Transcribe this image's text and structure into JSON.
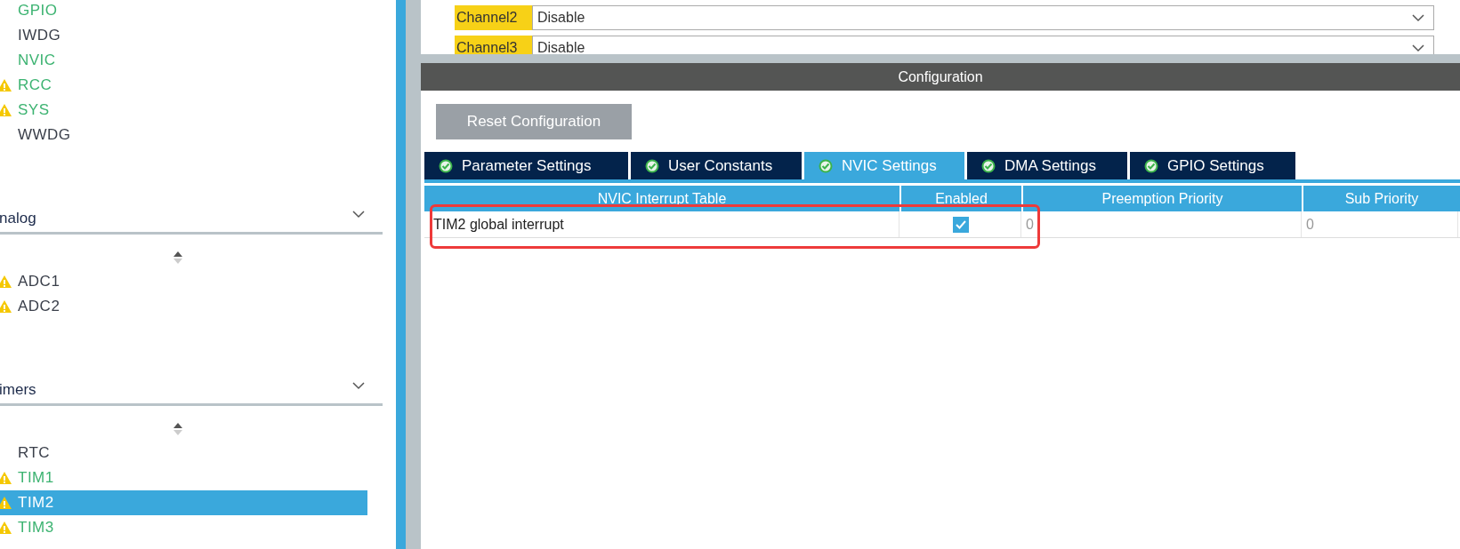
{
  "sidebar": {
    "groups": [
      {
        "items": [
          {
            "label": "GPIO",
            "configured": true,
            "warning": false,
            "selected": false
          },
          {
            "label": "IWDG",
            "configured": false,
            "warning": false,
            "selected": false
          },
          {
            "label": "NVIC",
            "configured": true,
            "warning": false,
            "selected": false
          },
          {
            "label": "RCC",
            "configured": true,
            "warning": true,
            "selected": false
          },
          {
            "label": "SYS",
            "configured": true,
            "warning": true,
            "selected": false
          },
          {
            "label": "WWDG",
            "configured": false,
            "warning": false,
            "selected": false
          }
        ]
      },
      {
        "header": "nalog",
        "expanded": true,
        "items": [
          {
            "label": "ADC1",
            "configured": false,
            "warning": true,
            "selected": false
          },
          {
            "label": "ADC2",
            "configured": false,
            "warning": true,
            "selected": false
          }
        ]
      },
      {
        "header": "imers",
        "expanded": true,
        "items": [
          {
            "label": "RTC",
            "configured": false,
            "warning": false,
            "selected": false
          },
          {
            "label": "TIM1",
            "configured": true,
            "warning": true,
            "selected": false
          },
          {
            "label": "TIM2",
            "configured": true,
            "warning": true,
            "selected": true
          },
          {
            "label": "TIM3",
            "configured": true,
            "warning": true,
            "selected": false
          }
        ]
      }
    ]
  },
  "parameters": [
    {
      "label": "Channel2",
      "value": "Disable"
    },
    {
      "label": "Channel3",
      "value": "Disable"
    }
  ],
  "configuration": {
    "title": "Configuration",
    "reset_button": "Reset Configuration",
    "tabs": [
      {
        "label": "Parameter Settings",
        "selected": false
      },
      {
        "label": "User Constants",
        "selected": false
      },
      {
        "label": "NVIC Settings",
        "selected": true
      },
      {
        "label": "DMA Settings",
        "selected": false
      },
      {
        "label": "GPIO Settings",
        "selected": false
      }
    ],
    "table": {
      "columns": [
        "NVIC Interrupt Table",
        "Enabled",
        "Preemption Priority",
        "Sub Priority"
      ],
      "rows": [
        {
          "name": "TIM2 global interrupt",
          "enabled": true,
          "preemption_priority": "0",
          "sub_priority": "0"
        }
      ]
    }
  }
}
